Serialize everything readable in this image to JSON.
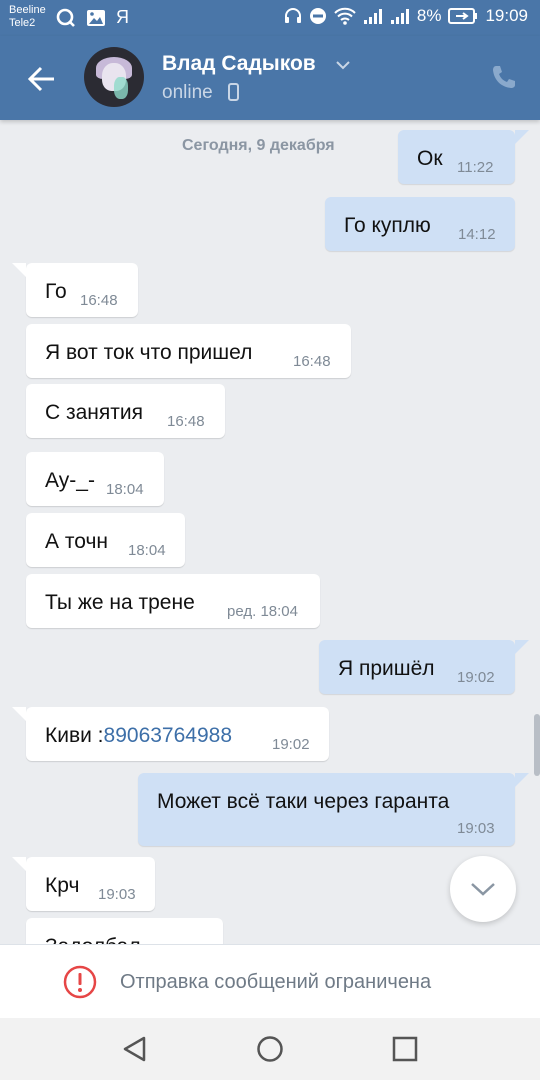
{
  "status_bar": {
    "carrier_1": "Beeline",
    "carrier_2": "Tele2",
    "left_icons": [
      "q-app-icon",
      "gallery-icon",
      "yandex-icon"
    ],
    "yandex_glyph": "Я",
    "battery": "8%",
    "time": "19:09"
  },
  "header": {
    "contact_name": "Влад Садыков",
    "status": "online"
  },
  "chat": {
    "date_separator": "Сегодня, 9 декабря",
    "messages": [
      {
        "dir": "out",
        "text": "Ок",
        "time": "11:22"
      },
      {
        "dir": "out",
        "text": "Го куплю",
        "time": "14:12"
      },
      {
        "dir": "in",
        "text": "Го",
        "time": "16:48"
      },
      {
        "dir": "in",
        "text": "Я вот ток что пришел",
        "time": "16:48"
      },
      {
        "dir": "in",
        "text": "С занятия",
        "time": "16:48"
      },
      {
        "dir": "in",
        "text": "Ау-_-",
        "time": "18:04"
      },
      {
        "dir": "in",
        "text": "А точн",
        "time": "18:04"
      },
      {
        "dir": "in",
        "text": "Ты же на трене",
        "time": "ред. 18:04"
      },
      {
        "dir": "out",
        "text": "Я пришёл",
        "time": "19:02"
      },
      {
        "dir": "in",
        "text_prefix": "Киви :",
        "link": "89063764988",
        "time": "19:02"
      },
      {
        "dir": "out",
        "text": "Может всё таки через гаранта",
        "time": "19:03"
      },
      {
        "dir": "in",
        "text": "Крч",
        "time": "19:03"
      },
      {
        "dir": "in",
        "text": "Задолбал",
        "time": ""
      }
    ]
  },
  "restriction": {
    "text": "Отправка сообщений ограничена"
  },
  "colors": {
    "header_bg": "#4a76a8",
    "chat_bg": "#ebedf0",
    "incoming_bubble": "#ffffff",
    "outgoing_bubble": "#cfe0f5",
    "link": "#3d6fa8",
    "warning": "#e64646"
  }
}
